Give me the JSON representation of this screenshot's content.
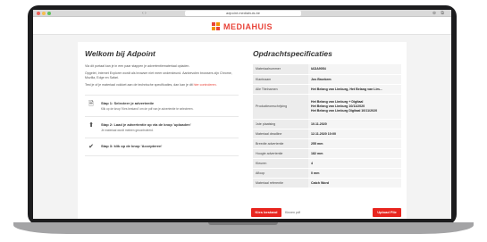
{
  "browser": {
    "url": "adpoint.mediahuis.be"
  },
  "header": {
    "brand": "MEDIAHUIS"
  },
  "left": {
    "title": "Welkom bij Adpoint",
    "paragraphs": [
      "Via dit portaal kan je in een paar stappen je advertentiemateriaal opladen.",
      "Opgelet, Internet Explorer wordt als browser niet meer ondersteund. Aanbevolen browsers zijn Chrome, Mozilla, Edge en Safari."
    ],
    "check_text": "Test je of je materiaal voldoet aan de technische specificaties, dan kan je dit",
    "check_link": "hier controleren.",
    "steps": [
      {
        "icon": "document-icon",
        "glyph": "🗎",
        "title": "Stap 1: Selecteer je advertentie",
        "sub": "Klik op de knop 'Kies bestand' om de pdf van je advertentie te selecteren."
      },
      {
        "icon": "upload-icon",
        "glyph": "⬆",
        "title": "Stap 2: Laad je advertentie op via de knop 'uploaden'",
        "sub": "Je materiaal wordt meteen gecontroleerd."
      },
      {
        "icon": "check-icon",
        "glyph": "✔",
        "title": "Stap 3: klik op de knop 'Accepteren'",
        "sub": ""
      }
    ]
  },
  "right": {
    "title": "Opdrachtspecificaties",
    "rows": [
      {
        "key": "Materiaalnummer",
        "value": "IADA9054"
      },
      {
        "key": "Klantnaam",
        "value": "Jos Broekem"
      },
      {
        "key": "Alle Titelnamen",
        "value": "Het Belang van Limburg, Het Belang van Lim..."
      },
      {
        "key": "Productieomschrijving",
        "lines": [
          "Het Belang van Limburg + Digitaal",
          "Het Belang van Limburg 10/11/2020",
          "Het Belang van Limburg Digitaal 10/11/2020"
        ]
      },
      {
        "key": "1ste plaatsing",
        "value": "10.11.2020"
      },
      {
        "key": "Materiaal deadline",
        "value": "12.11.2020 10:00"
      },
      {
        "key": "Breedte advertentie",
        "value": "255 mm"
      },
      {
        "key": "Hoogte advertentie",
        "value": "182 mm"
      },
      {
        "key": "Kleuren",
        "value": "4"
      },
      {
        "key": "Afloop",
        "value": "0 mm"
      },
      {
        "key": "Materiaal referentie",
        "value": "Catch Word"
      }
    ]
  },
  "footer": {
    "choose_file": "Kies bestand",
    "no_file": "Kiezen pdf",
    "upload": "Upload File"
  },
  "colors": {
    "brand_red": "#e8443a",
    "button_red": "#e8251f"
  }
}
